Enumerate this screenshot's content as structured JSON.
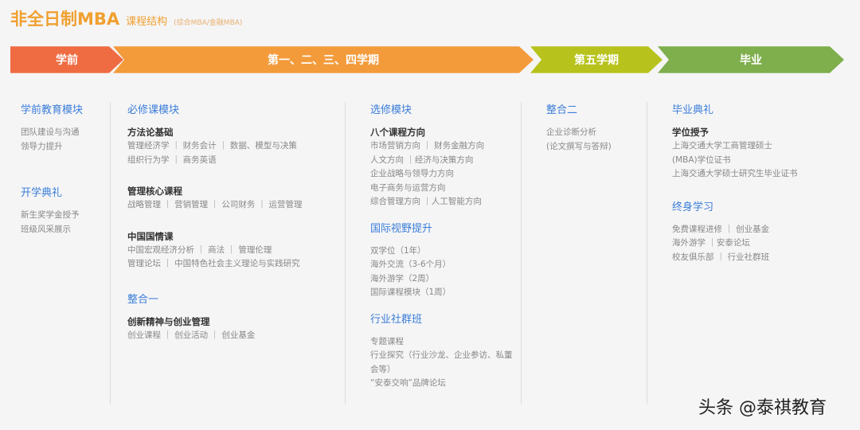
{
  "header": {
    "title": "非全日制MBA",
    "subtitle": "课程结构",
    "note": "(综合MBA/金融MBA)"
  },
  "stages": [
    {
      "label": "学前",
      "color": "#ef6c42"
    },
    {
      "label": "第一、二、三、四学期",
      "color": "#f39b3b"
    },
    {
      "label": "第五学期",
      "color": "#b7c31c"
    },
    {
      "label": "毕业",
      "color": "#7fae4d"
    }
  ],
  "columns": {
    "pre": {
      "h1": "学前教育模块",
      "items1": [
        "团队建设与沟通",
        "领导力提升"
      ],
      "h2": "开学典礼",
      "items2": [
        "新生奖学金授予",
        "班级风采展示"
      ]
    },
    "required": {
      "h": "必修课模块",
      "g1": {
        "b": "方法论基础",
        "items": [
          "管理经济学  ｜  财务会计  ｜  数据、模型与决策",
          "组织行为学  ｜  商务英语"
        ]
      },
      "g2": {
        "b": "管理核心课程",
        "items": [
          "战略管理  ｜  营销管理  ｜  公司财务 ｜  运营管理"
        ]
      },
      "g3": {
        "b": "中国国情课",
        "items": [
          "中国宏观经济分析  ｜  商法  ｜  管理伦理",
          "管理论坛  ｜  中国特色社会主义理论与实践研究"
        ]
      },
      "h2": "整合一",
      "g4": {
        "b": "创新精神与创业管理",
        "items": [
          "创业课程  ｜  创业活动  ｜  创业基金"
        ]
      }
    },
    "elective": {
      "h": "选修模块",
      "g1": {
        "b": "八个课程方向",
        "items": [
          "市场营销方向  ｜  财务金融方向",
          "人文方向  ｜经济与决策方向",
          "企业战略与领导力方向",
          "电子商务与运营方向",
          "综合管理方向  ｜人工智能方向"
        ]
      },
      "h2": "国际视野提升",
      "items2": [
        "双学位（1年）",
        "海外交流（3-6个月）",
        "海外游学（2周）",
        "国际课程模块（1周）"
      ],
      "h3": "行业社群班",
      "items3": [
        "专题课程",
        "行业探究（行业沙龙、企业参访、私董",
        "会等）",
        "“安泰交响”品牌论坛"
      ]
    },
    "fifth": {
      "h": "整合二",
      "items": [
        "企业诊断分析",
        "(论文撰写与答辩)"
      ]
    },
    "grad": {
      "h": "毕业典礼",
      "b": "学位授予",
      "items": [
        "上海交通大学工商管理硕士",
        "(MBA)学位证书",
        "上海交通大学硕士研究生毕业证书"
      ],
      "h2": "终身学习",
      "items2": [
        "免费课程进修  ｜  创业基金",
        "海外游学  ｜安泰论坛",
        "校友俱乐部  ｜  行业社群班"
      ]
    }
  },
  "watermark": "头条 @泰祺教育"
}
